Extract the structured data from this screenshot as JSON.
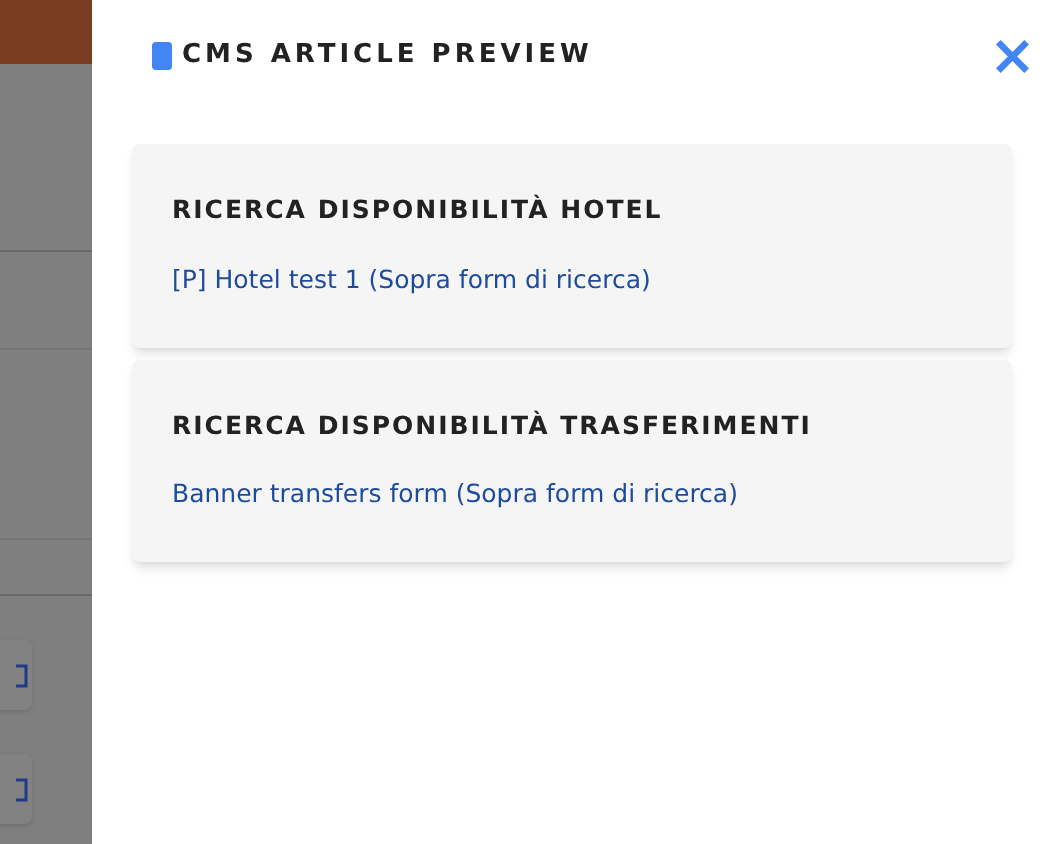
{
  "panel": {
    "title": "CMS ARTICLE PREVIEW",
    "close_icon": "×"
  },
  "articles": [
    {
      "heading": "RICERCA DISPONIBILITÀ HOTEL",
      "link": "[P] Hotel test 1 (Sopra form di ricerca)"
    },
    {
      "heading": "RICERCA DISPONIBILITÀ TRASFERIMENTI",
      "link": "Banner transfers form (Sopra form di ricerca)"
    }
  ]
}
